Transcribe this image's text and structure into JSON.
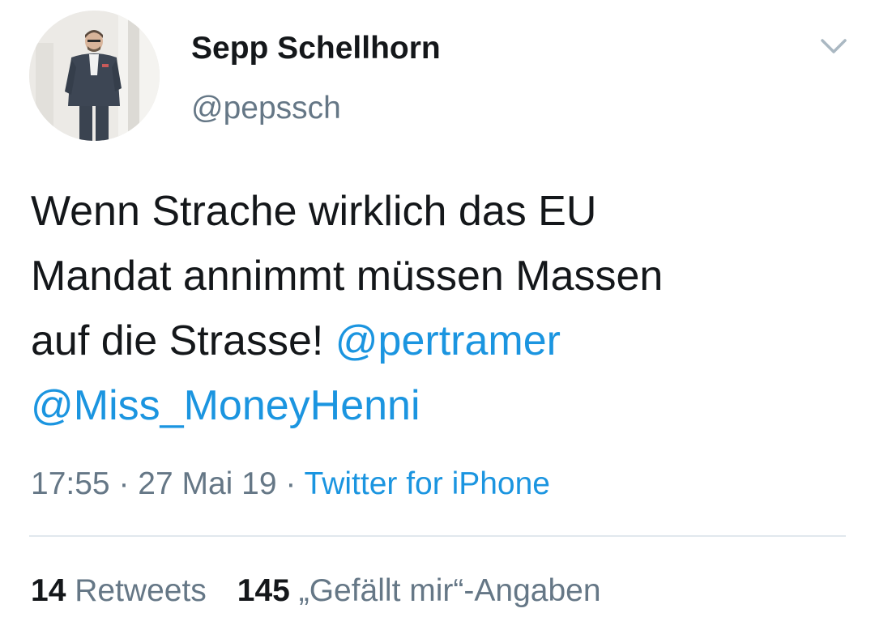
{
  "author": {
    "display_name": "Sepp Schellhorn",
    "handle": "@pepssch",
    "avatar_icon": "profile-photo"
  },
  "header": {
    "menu_icon": "chevron-down-icon"
  },
  "tweet": {
    "text_line_1": "Wenn Strache wirklich das EU",
    "text_line_2": "Mandat annimmt müssen Massen",
    "text_line_3_plain": "auf die Strasse! ",
    "mention_1": "@pertramer",
    "mention_2": "@Miss_MoneyHenni"
  },
  "meta": {
    "time": "17:55",
    "separator_1": " · ",
    "date": "27 Mai 19",
    "separator_2": " · ",
    "source": "Twitter for iPhone"
  },
  "stats": {
    "retweets_count": "14",
    "retweets_label": " Retweets",
    "likes_count": "145",
    "likes_label": " „Gefällt mir“-Angaben"
  },
  "colors": {
    "text": "#14171a",
    "secondary": "#657786",
    "link": "#1b95e0",
    "divider": "#e1e8ed"
  }
}
